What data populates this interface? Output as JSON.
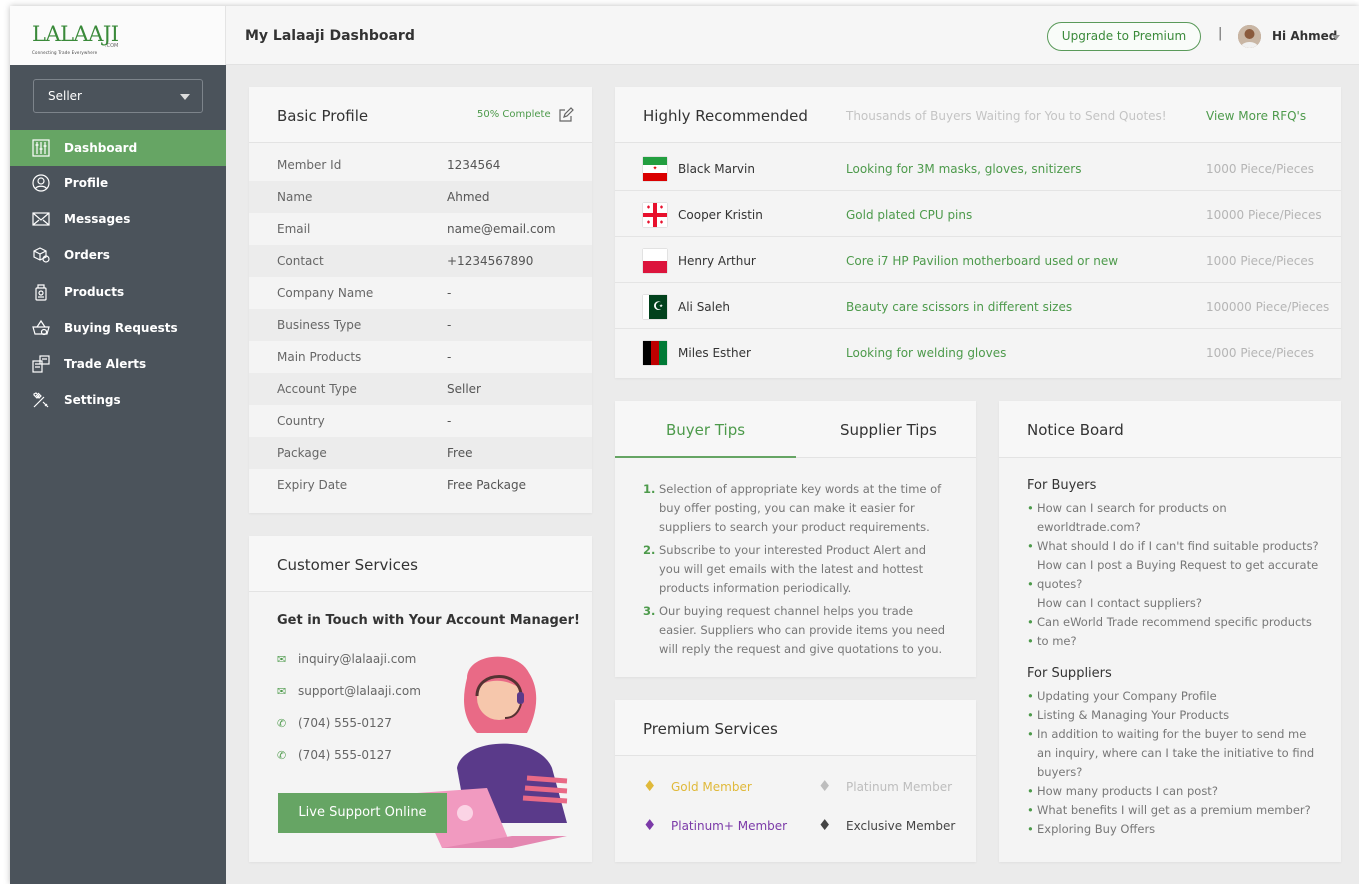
{
  "header": {
    "logo_text": "LALAAJI",
    "logo_tagline": "Connecting Trade Everywhere",
    "logo_domain": ".COM",
    "title": "My Lalaaji Dashboard",
    "upgrade_label": "Upgrade to Premium",
    "separator": "|",
    "user_greeting": "Hi Ahmed"
  },
  "sidebar": {
    "role_select": "Seller",
    "items": [
      {
        "label": "Dashboard",
        "icon": "dashboard-icon",
        "active": true
      },
      {
        "label": "Profile",
        "icon": "profile-icon"
      },
      {
        "label": "Messages",
        "icon": "messages-icon"
      },
      {
        "label": "Orders",
        "icon": "orders-icon"
      },
      {
        "label": "Products",
        "icon": "products-icon"
      },
      {
        "label": "Buying Requests",
        "icon": "buying-requests-icon"
      },
      {
        "label": "Trade Alerts",
        "icon": "trade-alerts-icon"
      },
      {
        "label": "Settings",
        "icon": "settings-icon"
      }
    ]
  },
  "profile": {
    "title": "Basic Profile",
    "completion": "50% Complete",
    "rows": [
      {
        "k": "Member Id",
        "v": "1234564"
      },
      {
        "k": "Name",
        "v": "Ahmed"
      },
      {
        "k": "Email",
        "v": "name@email.com"
      },
      {
        "k": "Contact",
        "v": "+1234567890"
      },
      {
        "k": "Company Name",
        "v": "-"
      },
      {
        "k": "Business Type",
        "v": "-"
      },
      {
        "k": "Main Products",
        "v": "-"
      },
      {
        "k": "Account Type",
        "v": "Seller"
      },
      {
        "k": "Country",
        "v": "-"
      },
      {
        "k": "Package",
        "v": "Free"
      },
      {
        "k": "Expiry Date",
        "v": "Free Package"
      }
    ]
  },
  "recommended": {
    "title": "Highly Recommended",
    "subtitle": "Thousands of Buyers Waiting for You to Send Quotes!",
    "view_more": "View More RFQ's",
    "rows": [
      {
        "name": "Black Marvin",
        "desc": "Looking for 3M masks, gloves, snitizers",
        "qty": "1000 Piece/Pieces",
        "flag": "iran"
      },
      {
        "name": "Cooper Kristin",
        "desc": "Gold plated CPU pins",
        "qty": "10000 Piece/Pieces",
        "flag": "georgia"
      },
      {
        "name": "Henry Arthur",
        "desc": "Core i7 HP Pavilion motherboard used or new",
        "qty": "1000 Piece/Pieces",
        "flag": "poland"
      },
      {
        "name": "Ali Saleh",
        "desc": "Beauty care scissors in different sizes",
        "qty": "100000 Piece/Pieces",
        "flag": "pakistan"
      },
      {
        "name": "Miles Esther",
        "desc": "Looking for welding gloves",
        "qty": "1000 Piece/Pieces",
        "flag": "afghanistan"
      }
    ]
  },
  "tips": {
    "tab_buyer": "Buyer Tips",
    "tab_supplier": "Supplier Tips",
    "items": [
      {
        "n": "1.",
        "text": "Selection of appropriate key words at the time of buy offer posting, you can make it easier for suppliers to search your product requirements."
      },
      {
        "n": "2.",
        "text": "Subscribe to your interested Product Alert and you will get emails with the latest and hottest products information periodically."
      },
      {
        "n": "3.",
        "text": "Our buying request channel helps you trade easier. Suppliers who can provide items you need will reply the request and give quotations to you."
      }
    ]
  },
  "notice": {
    "title": "Notice Board",
    "buyers_title": "For Buyers",
    "buyers": [
      {
        "t": "How can I search for products on",
        "b": true
      },
      {
        "t": "eworldtrade.com?",
        "b": false
      },
      {
        "t": "What should I do if I can't find suitable products?",
        "b": true
      },
      {
        "t": "How can I post a Buying Request to get accurate",
        "b": false
      },
      {
        "t": "quotes?",
        "b": true
      },
      {
        "t": "How can I contact suppliers?",
        "b": false
      },
      {
        "t": "Can eWorld Trade recommend specific products",
        "b": true
      },
      {
        "t": "to me?",
        "b": true
      }
    ],
    "suppliers_title": "For Suppliers",
    "suppliers": [
      {
        "t": "Updating your Company Profile",
        "b": true
      },
      {
        "t": "Listing & Managing Your Products",
        "b": true
      },
      {
        "t": "In addition to waiting for the buyer to send me",
        "b": true
      },
      {
        "t": "an inquiry, where can I take the initiative to find",
        "b": false
      },
      {
        "t": "buyers?",
        "b": false
      },
      {
        "t": "How many products I can post?",
        "b": true
      },
      {
        "t": "What benefits I will get as a premium member?",
        "b": true
      },
      {
        "t": "Exploring Buy Offers",
        "b": true
      }
    ]
  },
  "customer": {
    "title": "Customer Services",
    "heading": "Get in Touch with Your Account Manager!",
    "email1": "inquiry@lalaaji.com",
    "email2": "support@lalaaji.com",
    "phone1": "(704) 555-0127",
    "phone2": "(704) 555-0127",
    "live_label": "Live Support Online"
  },
  "premium": {
    "title": "Premium Services",
    "gold": "Gold Member",
    "platinum": "Platinum Member",
    "platinum_plus": "Platinum+ Member",
    "exclusive": "Exclusive Member"
  },
  "colors": {
    "accent": "#66a564",
    "sidebar": "#4b535b",
    "gold": "#e0b93a",
    "platinum_plus": "#7b3aa8"
  }
}
